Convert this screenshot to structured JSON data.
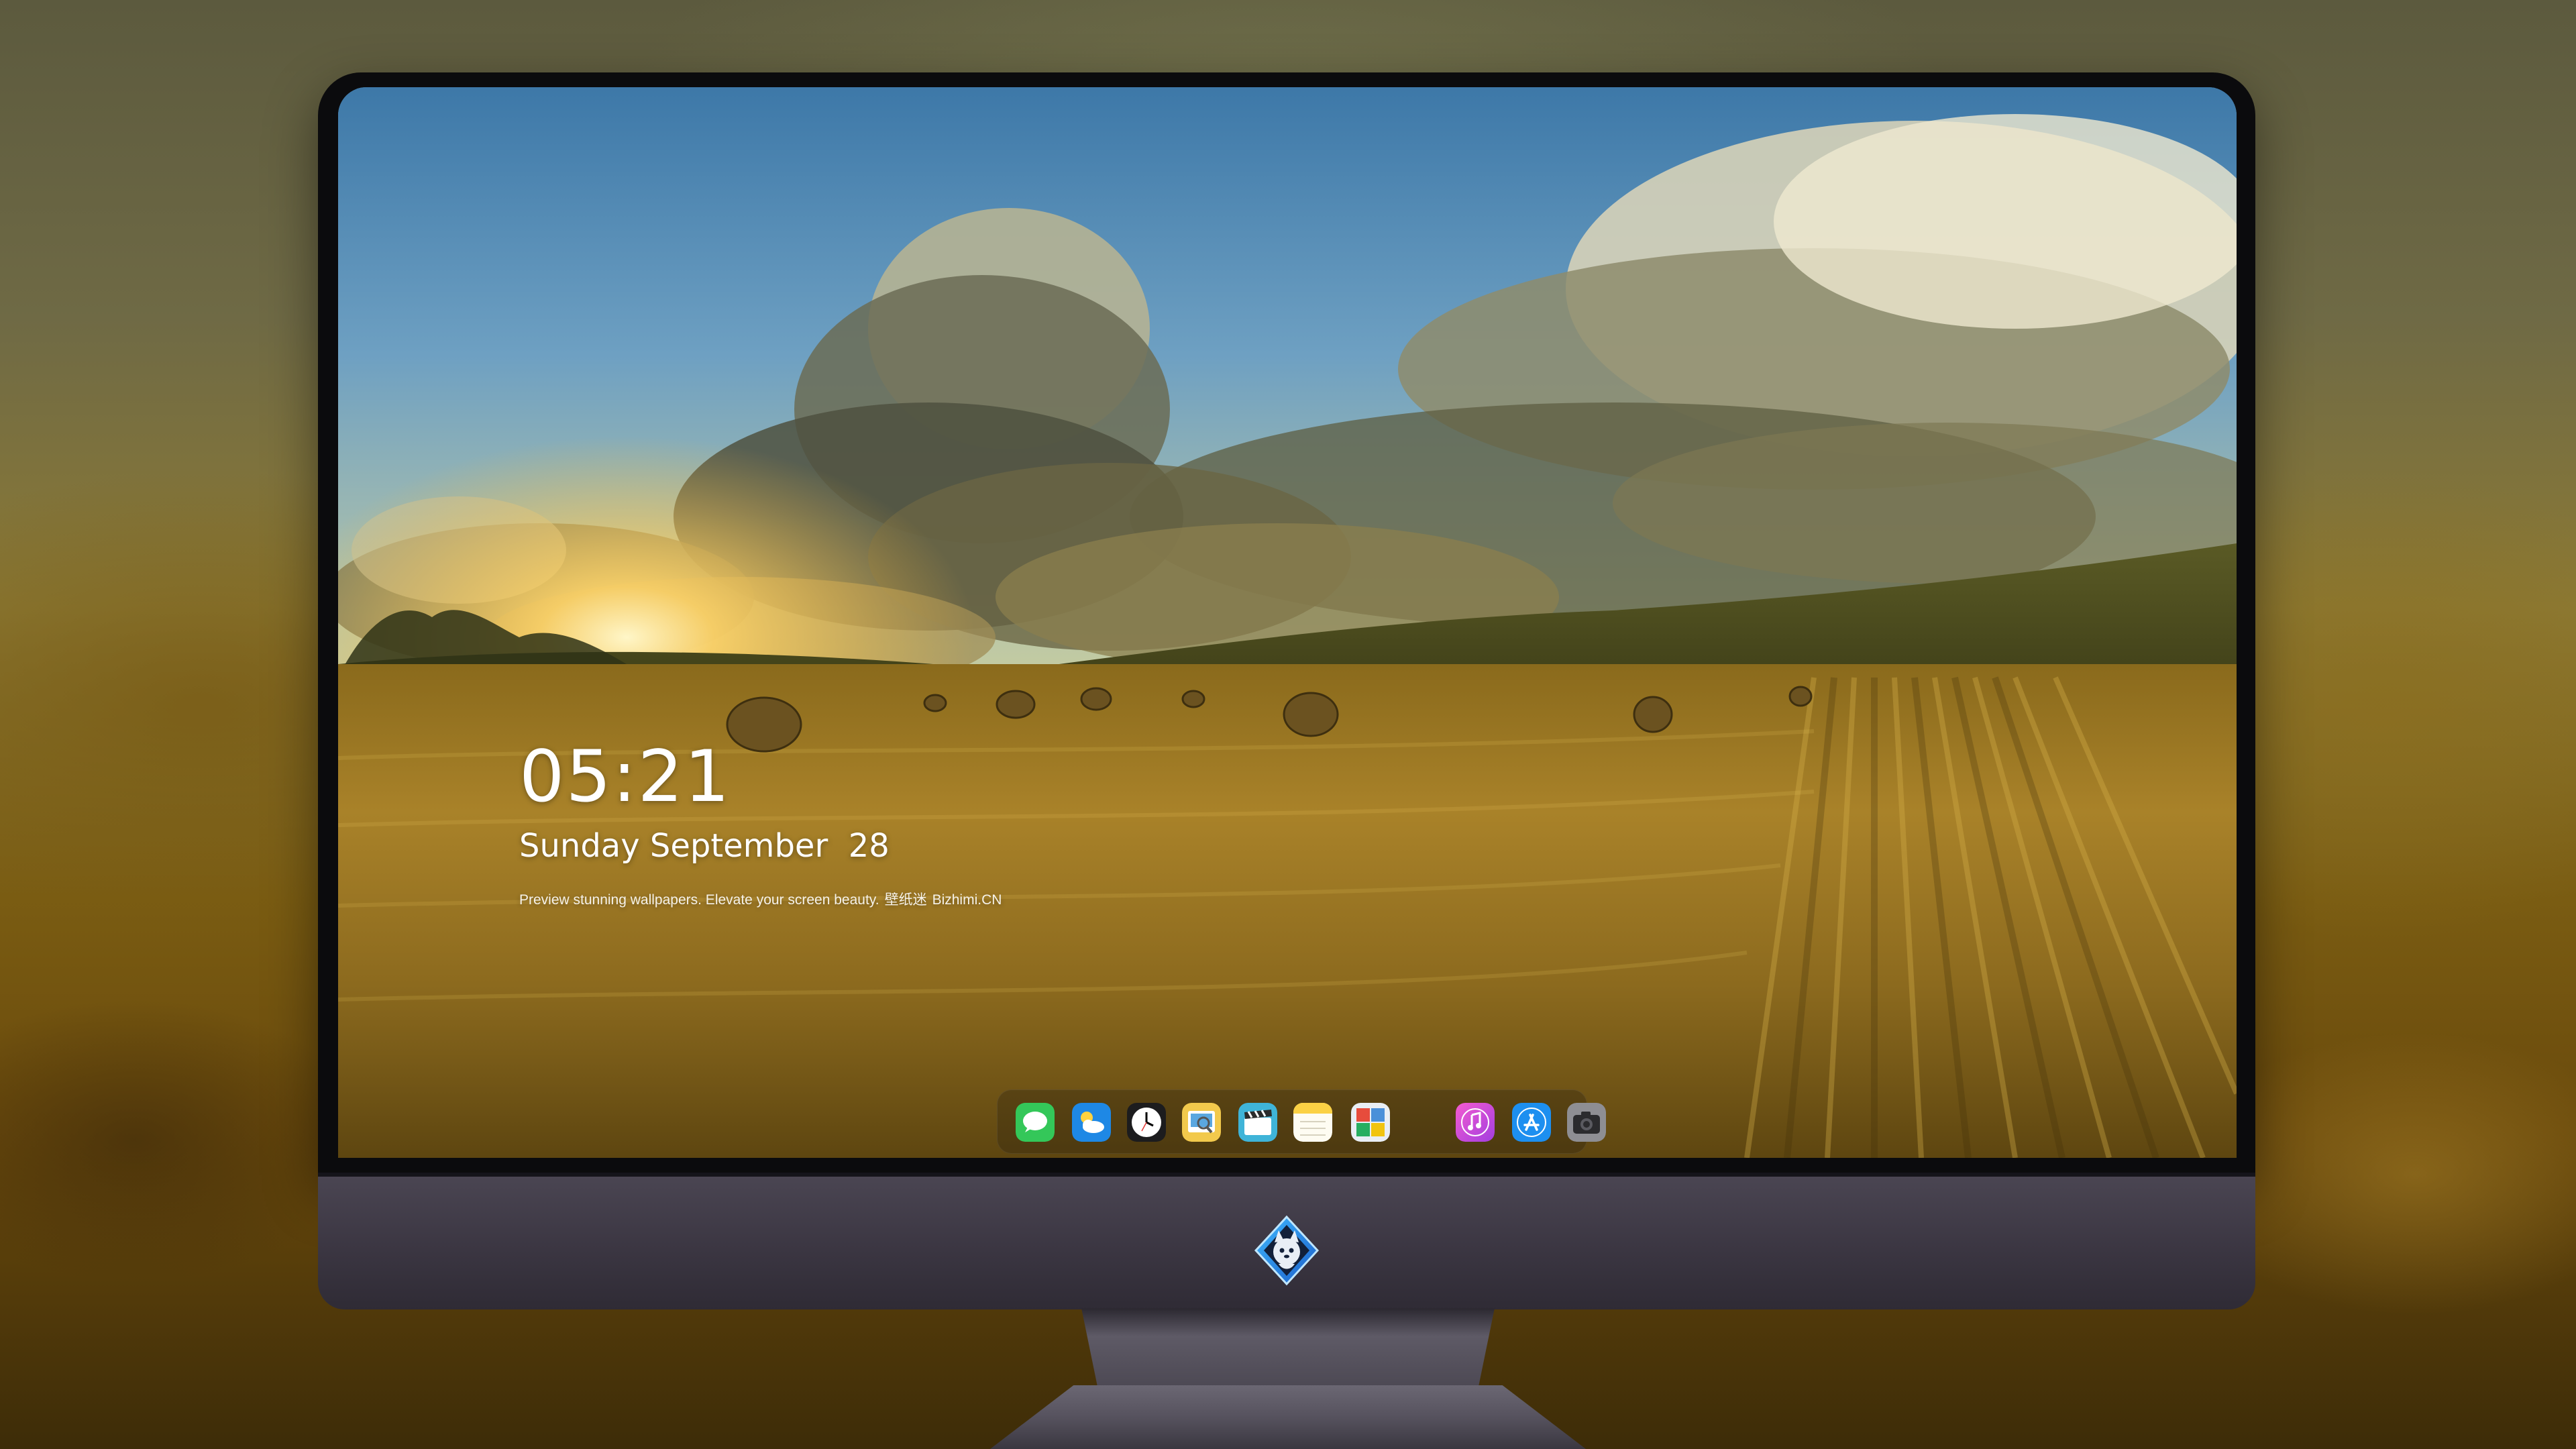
{
  "lockscreen": {
    "time": "05:21",
    "date": "Sunday September  28",
    "tagline_prefix": "Preview stunning wallpapers. Elevate your screen beauty.",
    "tagline_brand_cn": "壁纸迷",
    "tagline_brand_en": "Bizhimi.CN"
  },
  "dock": {
    "apps": [
      {
        "name": "messages",
        "icon": "messages-icon",
        "color": "#34c759"
      },
      {
        "name": "weather",
        "icon": "weather-icon",
        "color": "#1e88e5"
      },
      {
        "name": "clock",
        "icon": "clock-icon",
        "color": "#1c1c1e"
      },
      {
        "name": "preview",
        "icon": "preview-icon",
        "color": "#f2c94c"
      },
      {
        "name": "clips",
        "icon": "clapperboard-icon",
        "color": "#3fb4d8"
      },
      {
        "name": "notes",
        "icon": "notes-icon",
        "color": "#fbd144"
      },
      {
        "name": "photo-booth",
        "icon": "photo-booth-icon",
        "color": "#4a90d9"
      },
      {
        "name": "itunes",
        "icon": "music-note-icon",
        "color": "#d843c9"
      },
      {
        "name": "app-store",
        "icon": "app-store-icon",
        "color": "#1d8ff0"
      },
      {
        "name": "camera",
        "icon": "camera-icon",
        "color": "#8e8e93"
      }
    ]
  },
  "monitor": {
    "brand_logo": "wolf-mascot-logo"
  }
}
